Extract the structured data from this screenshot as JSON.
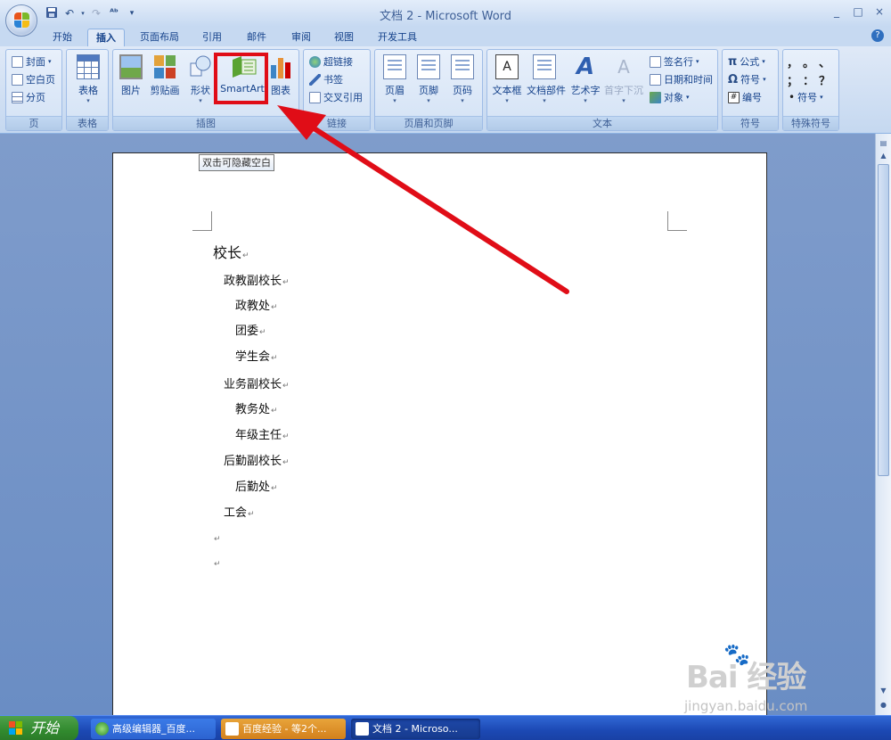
{
  "window": {
    "title": "文档 2 - Microsoft Word",
    "controls": [
      "_",
      "□",
      "×"
    ]
  },
  "qat": {
    "save_icon": "save-icon",
    "undo_icon": "undo-icon",
    "redo_icon": "redo-icon",
    "spelling_icon": "spelling-check-icon",
    "customize": "▾"
  },
  "tabs": [
    {
      "label": "开始"
    },
    {
      "label": "插入",
      "active": true
    },
    {
      "label": "页面布局"
    },
    {
      "label": "引用"
    },
    {
      "label": "邮件"
    },
    {
      "label": "审阅"
    },
    {
      "label": "视图"
    },
    {
      "label": "开发工具"
    }
  ],
  "ribbon": {
    "pages_group": {
      "label": "页",
      "cover": "封面",
      "blank": "空白页",
      "break": "分页"
    },
    "tables_group": {
      "label": "表格",
      "table": "表格"
    },
    "illustrations_group": {
      "label": "插图",
      "picture": "图片",
      "clipart": "剪贴画",
      "shapes": "形状",
      "smartart": "SmartArt",
      "chart": "图表"
    },
    "links_group": {
      "label": "链接",
      "hyperlink": "超链接",
      "bookmark": "书签",
      "crossref": "交叉引用"
    },
    "header_footer_group": {
      "label": "页眉和页脚",
      "header": "页眉",
      "footer": "页脚",
      "pagenum": "页码"
    },
    "text_group": {
      "label": "文本",
      "textbox": "文本框",
      "quickparts": "文档部件",
      "wordart": "艺术字",
      "dropcap": "首字下沉",
      "signature": "签名行",
      "datetime": "日期和时间",
      "object": "对象"
    },
    "symbols_group": {
      "label": "符号",
      "equation": "公式",
      "symbol": "符号",
      "number": "编号"
    },
    "special_group": {
      "label": "特殊符号",
      "symbol": "符号",
      "glyphs": [
        "，",
        "。",
        "、",
        "；",
        "：",
        "？"
      ]
    }
  },
  "tooltip": "双击可隐藏空白",
  "document": {
    "lines": [
      {
        "text": "校长",
        "level": 0
      },
      {
        "text": "政教副校长",
        "level": 1
      },
      {
        "text": "政教处",
        "level": 2
      },
      {
        "text": "团委",
        "level": 2
      },
      {
        "text": "学生会",
        "level": 2
      },
      {
        "text": "业务副校长",
        "level": 1
      },
      {
        "text": "教务处",
        "level": 2
      },
      {
        "text": "年级主任",
        "level": 2
      },
      {
        "text": "后勤副校长",
        "level": 1
      },
      {
        "text": "后勤处",
        "level": 2
      },
      {
        "text": "工会",
        "level": 1
      },
      {
        "text": "",
        "level": 0
      },
      {
        "text": "",
        "level": 0
      }
    ],
    "paragraph_mark": "↵"
  },
  "watermark": {
    "main": "Bai 经验",
    "sub": "jingyan.baidu.com"
  },
  "taskbar": {
    "start": "开始",
    "items": [
      {
        "label": "高级编辑器_百度..."
      },
      {
        "label": "百度经验 - 等2个..."
      },
      {
        "label": "文档 2 - Microso..."
      }
    ]
  },
  "colors": {
    "highlight": "#e00d17",
    "arrow": "#e00d17"
  }
}
